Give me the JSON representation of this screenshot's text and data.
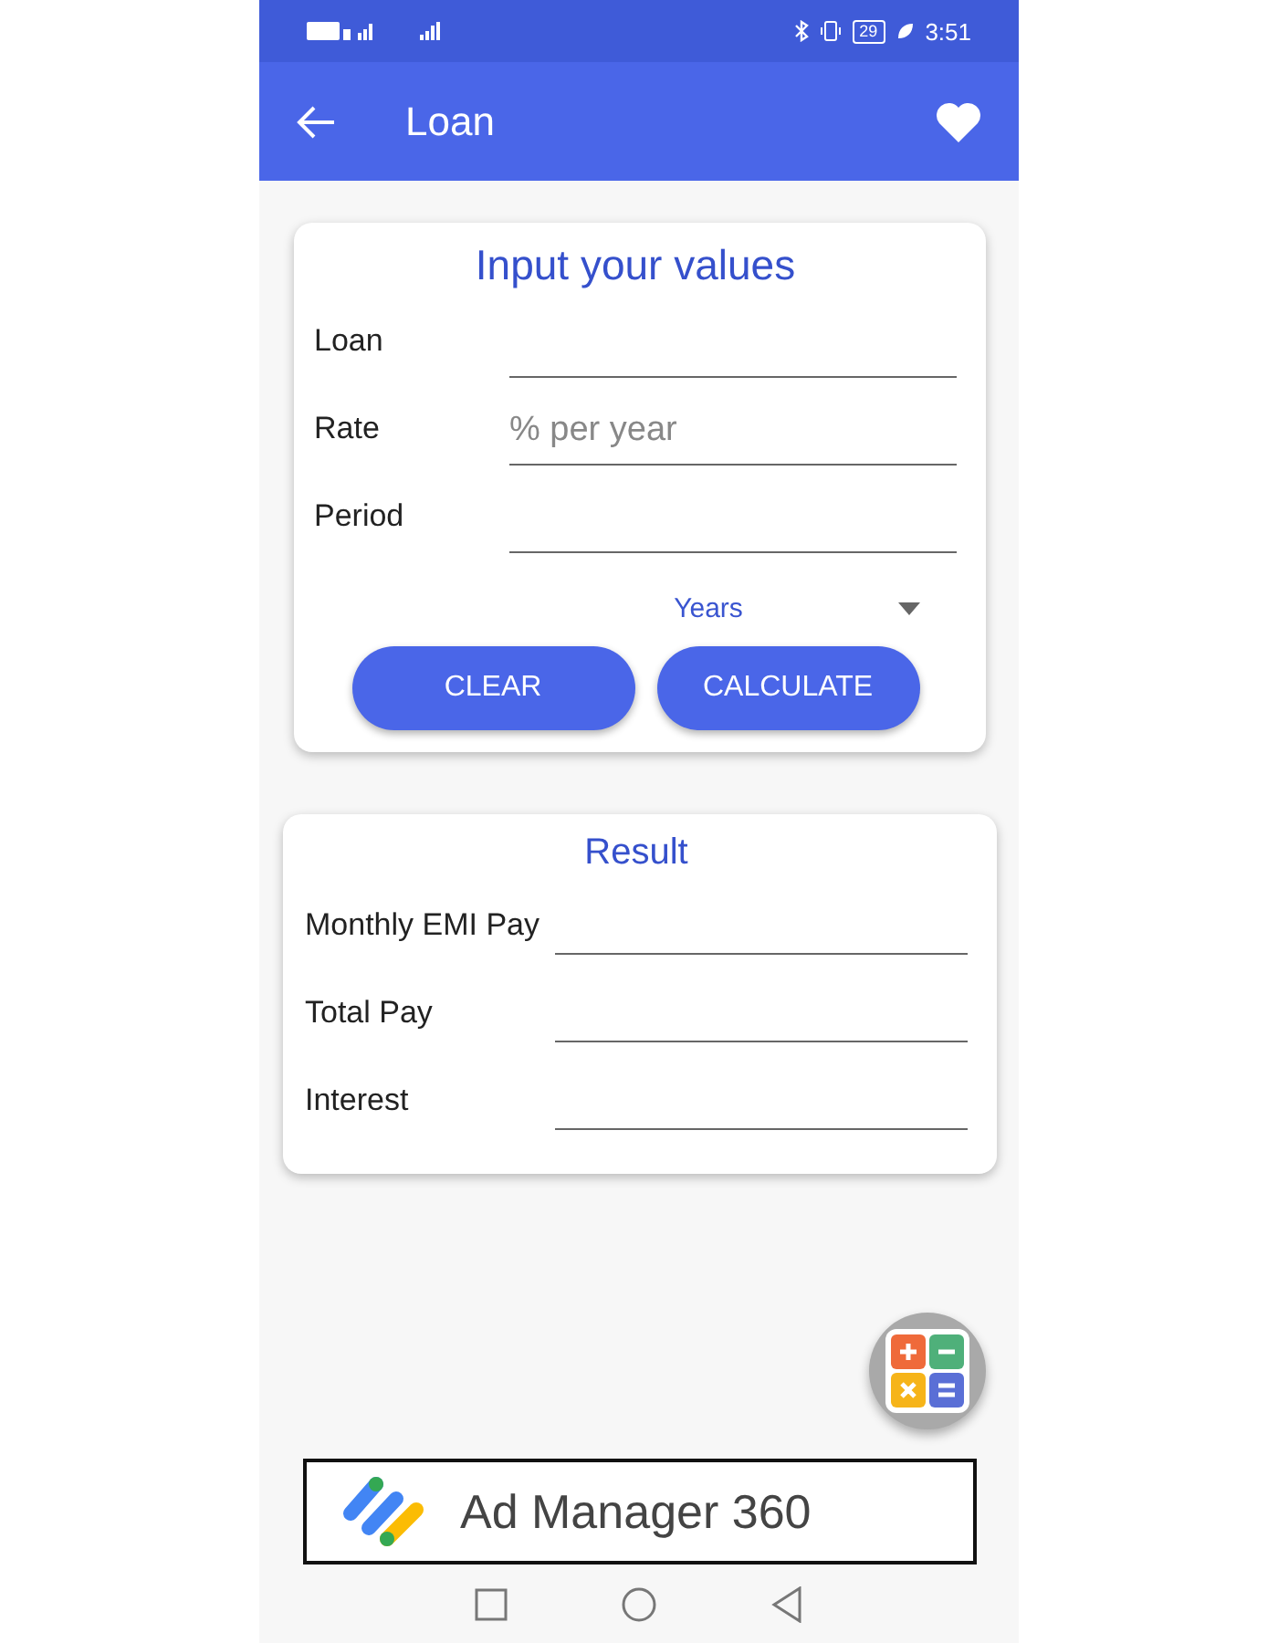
{
  "status_bar": {
    "battery": "29",
    "time": "3:51"
  },
  "app_bar": {
    "title": "Loan"
  },
  "input_card": {
    "title": "Input your values",
    "fields": [
      {
        "label": "Loan"
      },
      {
        "label": "Rate",
        "placeholder": "% per year"
      },
      {
        "label": "Period"
      }
    ],
    "unit_dropdown": {
      "value": "Years"
    },
    "buttons": [
      "CLEAR",
      "CALCULATE"
    ]
  },
  "result_card": {
    "title": "Result",
    "rows": [
      {
        "label": "Monthly EMI Pay"
      },
      {
        "label": "Total Pay"
      },
      {
        "label": "Interest"
      }
    ]
  },
  "ad_banner": {
    "text": "Ad Manager 360"
  }
}
